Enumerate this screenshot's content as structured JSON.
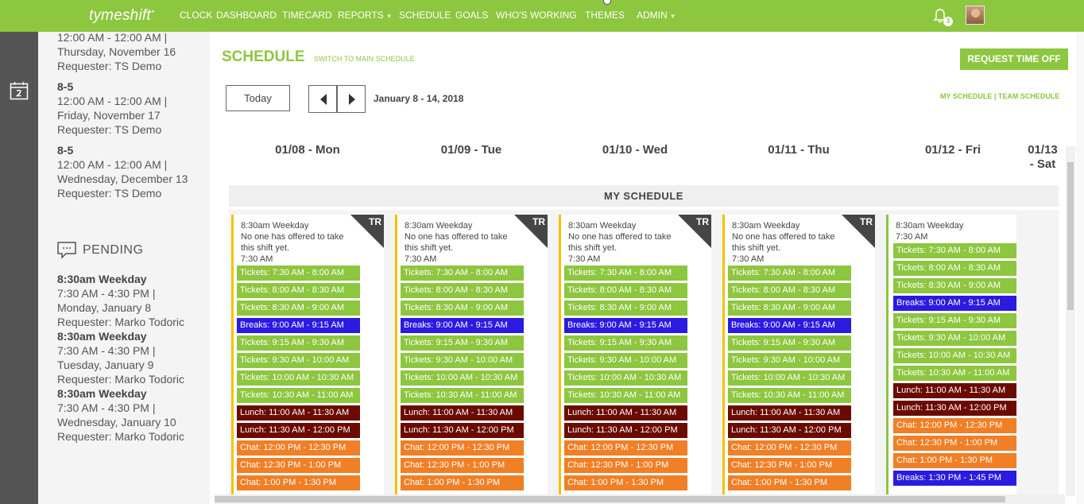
{
  "app": {
    "logo_text": "tymeshift",
    "logo_mark": "+"
  },
  "nav": [
    {
      "label": "CLOCK"
    },
    {
      "label": "DASHBOARD"
    },
    {
      "label": "TIMECARD"
    },
    {
      "label": "REPORTS"
    },
    {
      "label": "SCHEDULE"
    },
    {
      "label": "GOALS"
    },
    {
      "label": "WHO'S WORKING"
    },
    {
      "label": "THEMES"
    },
    {
      "label": "ADMIN"
    }
  ],
  "header": {
    "notification_count": "3"
  },
  "sidebar": {
    "approved": [
      {
        "title": "",
        "line1": "12:00 AM - 12:00 AM |",
        "line2": "Thursday, November 16",
        "line3": "Requester: TS Demo"
      },
      {
        "title": "8-5",
        "line1": "12:00 AM - 12:00 AM |",
        "line2": "Friday, November 17",
        "line3": "Requester: TS Demo"
      },
      {
        "title": "8-5",
        "line1": "12:00 AM - 12:00 AM |",
        "line2": "Wednesday, December 13",
        "line3": "Requester: TS Demo"
      }
    ],
    "pending_label": "PENDING",
    "pending": [
      {
        "title": "8:30am Weekday",
        "line1": "7:30 AM - 4:30 PM |",
        "line2": "Monday, January 8",
        "line3": "Requester: Marko Todoric"
      },
      {
        "title": "8:30am Weekday",
        "line1": "7:30 AM - 4:30 PM |",
        "line2": "Tuesday, January 9",
        "line3": "Requester: Marko Todoric"
      },
      {
        "title": "8:30am Weekday",
        "line1": "7:30 AM - 4:30 PM |",
        "line2": "Wednesday, January 10",
        "line3": "Requester: Marko Todoric"
      }
    ]
  },
  "main": {
    "title": "SCHEDULE",
    "switch_link": "SWITCH TO MAIN SCHEDULE",
    "request_button": "REQUEST TIME OFF",
    "today_button": "Today",
    "date_range": "January 8 - 14, 2018",
    "view_links": "MY SCHEDULE | TEAM SCHEDULE",
    "section_label": "MY SCHEDULE",
    "days": [
      "01/08 - Mon",
      "01/09 - Tue",
      "01/10 - Wed",
      "01/11 - Thu",
      "01/12 - Fri",
      "01/13 - Sat"
    ]
  },
  "colors": {
    "brand": "#8dc63f",
    "tickets": "#8dc63f",
    "breaks": "#2b1be0",
    "lunch": "#6b0b00",
    "chat": "#f07f26",
    "trade_badge": "#454545",
    "shift_border": "#f5c200"
  },
  "cards": [
    {
      "shift_name": "8:30am Weekday",
      "note": "No one has offered to take this shift yet.",
      "start": "7:30 AM",
      "badge": "TR",
      "blocks": [
        {
          "label": "Tickets: 7:30 AM - 8:00 AM",
          "type": "tickets"
        },
        {
          "label": "Tickets: 8:00 AM - 8:30 AM",
          "type": "tickets"
        },
        {
          "label": "Tickets: 8:30 AM - 9:00 AM",
          "type": "tickets"
        },
        {
          "label": "Breaks: 9:00 AM - 9:15 AM",
          "type": "breaks"
        },
        {
          "label": "Tickets: 9:15 AM - 9:30 AM",
          "type": "tickets"
        },
        {
          "label": "Tickets: 9:30 AM - 10:00 AM",
          "type": "tickets"
        },
        {
          "label": "Tickets: 10:00 AM - 10:30 AM",
          "type": "tickets"
        },
        {
          "label": "Tickets: 10:30 AM - 11:00 AM",
          "type": "tickets"
        },
        {
          "label": "Lunch: 11:00 AM - 11:30 AM",
          "type": "lunch"
        },
        {
          "label": "Lunch: 11:30 AM - 12:00 PM",
          "type": "lunch"
        },
        {
          "label": "Chat: 12:00 PM - 12:30 PM",
          "type": "chat"
        },
        {
          "label": "Chat: 12:30 PM - 1:00 PM",
          "type": "chat"
        },
        {
          "label": "Chat: 1:00 PM - 1:30 PM",
          "type": "chat"
        }
      ]
    },
    {
      "shift_name": "8:30am Weekday",
      "note": "No one has offered to take this shift yet.",
      "start": "7:30 AM",
      "badge": "TR",
      "blocks": [
        {
          "label": "Tickets: 7:30 AM - 8:00 AM",
          "type": "tickets"
        },
        {
          "label": "Tickets: 8:00 AM - 8:30 AM",
          "type": "tickets"
        },
        {
          "label": "Tickets: 8:30 AM - 9:00 AM",
          "type": "tickets"
        },
        {
          "label": "Breaks: 9:00 AM - 9:15 AM",
          "type": "breaks"
        },
        {
          "label": "Tickets: 9:15 AM - 9:30 AM",
          "type": "tickets"
        },
        {
          "label": "Tickets: 9:30 AM - 10:00 AM",
          "type": "tickets"
        },
        {
          "label": "Tickets: 10:00 AM - 10:30 AM",
          "type": "tickets"
        },
        {
          "label": "Tickets: 10:30 AM - 11:00 AM",
          "type": "tickets"
        },
        {
          "label": "Lunch: 11:00 AM - 11:30 AM",
          "type": "lunch"
        },
        {
          "label": "Lunch: 11:30 AM - 12:00 PM",
          "type": "lunch"
        },
        {
          "label": "Chat: 12:00 PM - 12:30 PM",
          "type": "chat"
        },
        {
          "label": "Chat: 12:30 PM - 1:00 PM",
          "type": "chat"
        },
        {
          "label": "Chat: 1:00 PM - 1:30 PM",
          "type": "chat"
        }
      ]
    },
    {
      "shift_name": "8:30am Weekday",
      "note": "No one has offered to take this shift yet.",
      "start": "7:30 AM",
      "badge": "TR",
      "blocks": [
        {
          "label": "Tickets: 7:30 AM - 8:00 AM",
          "type": "tickets"
        },
        {
          "label": "Tickets: 8:00 AM - 8:30 AM",
          "type": "tickets"
        },
        {
          "label": "Tickets: 8:30 AM - 9:00 AM",
          "type": "tickets"
        },
        {
          "label": "Breaks: 9:00 AM - 9:15 AM",
          "type": "breaks"
        },
        {
          "label": "Tickets: 9:15 AM - 9:30 AM",
          "type": "tickets"
        },
        {
          "label": "Tickets: 9:30 AM - 10:00 AM",
          "type": "tickets"
        },
        {
          "label": "Tickets: 10:00 AM - 10:30 AM",
          "type": "tickets"
        },
        {
          "label": "Tickets: 10:30 AM - 11:00 AM",
          "type": "tickets"
        },
        {
          "label": "Lunch: 11:00 AM - 11:30 AM",
          "type": "lunch"
        },
        {
          "label": "Lunch: 11:30 AM - 12:00 PM",
          "type": "lunch"
        },
        {
          "label": "Chat: 12:00 PM - 12:30 PM",
          "type": "chat"
        },
        {
          "label": "Chat: 12:30 PM - 1:00 PM",
          "type": "chat"
        },
        {
          "label": "Chat: 1:00 PM - 1:30 PM",
          "type": "chat"
        }
      ]
    },
    {
      "shift_name": "8:30am Weekday",
      "note": "No one has offered to take this shift yet.",
      "start": "7:30 AM",
      "badge": "TR",
      "blocks": [
        {
          "label": "Tickets: 7:30 AM - 8:00 AM",
          "type": "tickets"
        },
        {
          "label": "Tickets: 8:00 AM - 8:30 AM",
          "type": "tickets"
        },
        {
          "label": "Tickets: 8:30 AM - 9:00 AM",
          "type": "tickets"
        },
        {
          "label": "Breaks: 9:00 AM - 9:15 AM",
          "type": "breaks"
        },
        {
          "label": "Tickets: 9:15 AM - 9:30 AM",
          "type": "tickets"
        },
        {
          "label": "Tickets: 9:30 AM - 10:00 AM",
          "type": "tickets"
        },
        {
          "label": "Tickets: 10:00 AM - 10:30 AM",
          "type": "tickets"
        },
        {
          "label": "Tickets: 10:30 AM - 11:00 AM",
          "type": "tickets"
        },
        {
          "label": "Lunch: 11:00 AM - 11:30 AM",
          "type": "lunch"
        },
        {
          "label": "Lunch: 11:30 AM - 12:00 PM",
          "type": "lunch"
        },
        {
          "label": "Chat: 12:00 PM - 12:30 PM",
          "type": "chat"
        },
        {
          "label": "Chat: 12:30 PM - 1:00 PM",
          "type": "chat"
        },
        {
          "label": "Chat: 1:00 PM - 1:30 PM",
          "type": "chat"
        }
      ]
    },
    {
      "shift_name": "8:30am Weekday",
      "note": "",
      "start": "7:30 AM",
      "badge": "",
      "blocks": [
        {
          "label": "Tickets: 7:30 AM - 8:00 AM",
          "type": "tickets"
        },
        {
          "label": "Tickets: 8:00 AM - 8:30 AM",
          "type": "tickets"
        },
        {
          "label": "Tickets: 8:30 AM - 9:00 AM",
          "type": "tickets"
        },
        {
          "label": "Breaks: 9:00 AM - 9:15 AM",
          "type": "breaks"
        },
        {
          "label": "Tickets: 9:15 AM - 9:30 AM",
          "type": "tickets"
        },
        {
          "label": "Tickets: 9:30 AM - 10:00 AM",
          "type": "tickets"
        },
        {
          "label": "Tickets: 10:00 AM - 10:30 AM",
          "type": "tickets"
        },
        {
          "label": "Tickets: 10:30 AM - 11:00 AM",
          "type": "tickets"
        },
        {
          "label": "Lunch: 11:00 AM - 11:30 AM",
          "type": "lunch"
        },
        {
          "label": "Lunch: 11:30 AM - 12:00 PM",
          "type": "lunch"
        },
        {
          "label": "Chat: 12:00 PM - 12:30 PM",
          "type": "chat"
        },
        {
          "label": "Chat: 12:30 PM - 1:00 PM",
          "type": "chat"
        },
        {
          "label": "Chat: 1:00 PM - 1:30 PM",
          "type": "chat"
        },
        {
          "label": "Breaks: 1:30 PM - 1:45 PM",
          "type": "breaks"
        }
      ]
    }
  ]
}
